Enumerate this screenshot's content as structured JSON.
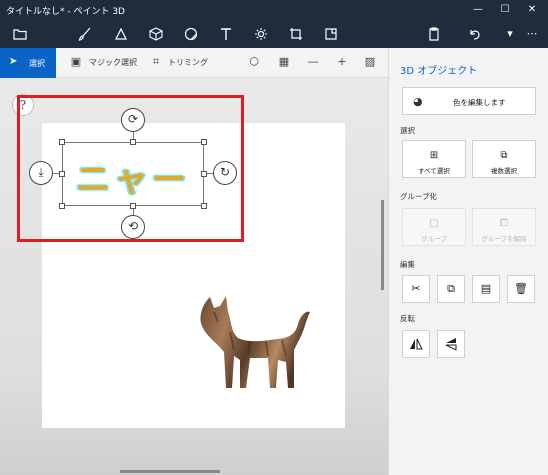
{
  "window": {
    "title": "タイトルなし* - ペイント 3D",
    "minimize": "—",
    "maximize": "☐",
    "close": "✕"
  },
  "toolbar": {
    "menu_icon": "folder-icon",
    "undo_icon": "undo-icon",
    "more": "⋯",
    "dropdown": "▾"
  },
  "subbar": {
    "select_label": "選択",
    "magic_select_label": "マジック選択",
    "crop_label": "トリミング",
    "zoom_out": "—",
    "zoom_in": "+"
  },
  "canvas": {
    "help": "?",
    "text_object": "ニャー"
  },
  "panel": {
    "title": "3D オブジェクト",
    "edit_color": "色を編集します",
    "section_select": "選択",
    "select_all": "すべて選択",
    "multi_select": "複数選択",
    "section_group": "グループ化",
    "group": "グループ",
    "ungroup": "グループを解除",
    "section_edit": "編集",
    "section_flip": "反転"
  }
}
